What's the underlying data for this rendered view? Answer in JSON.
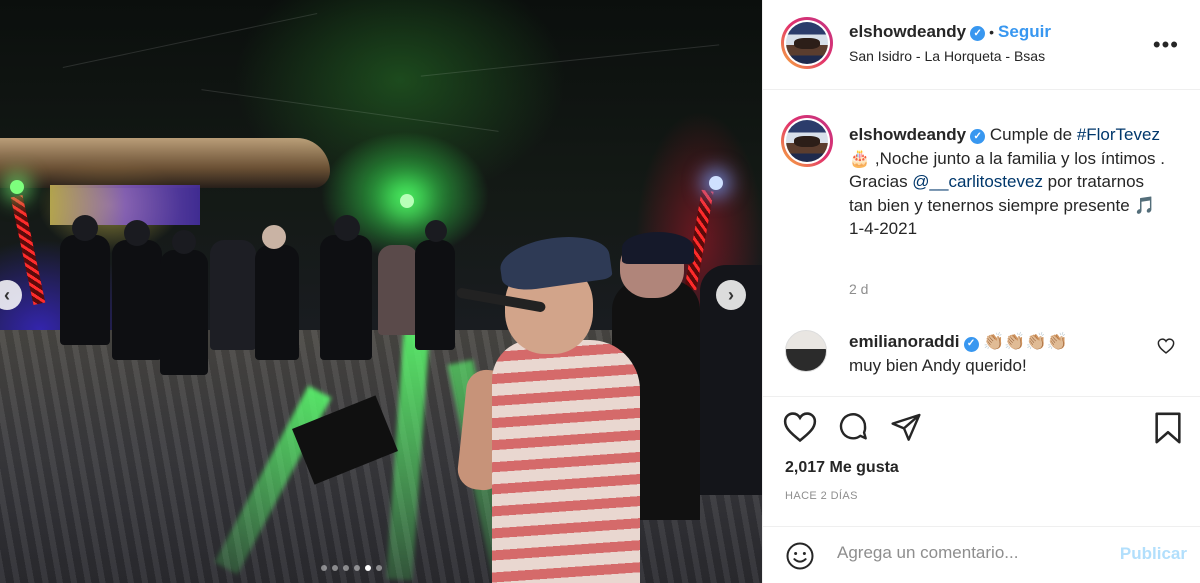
{
  "post": {
    "username": "elshowdeandy",
    "follow_label": "Seguir",
    "separator": "•",
    "location": "San Isidro - La Horqueta - Bsas",
    "more_label": "•••"
  },
  "caption": {
    "username": "elshowdeandy",
    "text_1": " Cumple de ",
    "hashtag": "#FlorTevez",
    "emoji_cake": "🎂",
    "text_2": " ,Noche junto a la familia y los íntimos . Gracias ",
    "mention": "@__carlitostevez",
    "text_3": " por tratarnos tan bien y tenernos siempre presente ",
    "emoji_music": "🎵",
    "date": "1-4-2021",
    "age": "2 d"
  },
  "comment": {
    "username": "emilianoraddi",
    "emojis": "👏🏼👏🏼👏🏼👏🏼",
    "text": "muy bien Andy querido!"
  },
  "stats": {
    "likes": "2,017 Me gusta",
    "time": "HACE 2 DÍAS"
  },
  "add_comment": {
    "placeholder": "Agrega un comentario...",
    "publish": "Publicar"
  },
  "carousel": {
    "prev": "‹",
    "next": "›",
    "total_slides": 6,
    "active_index": 4
  },
  "icons": {
    "verified": "verified-badge-icon",
    "like": "heart-icon",
    "comment": "comment-icon",
    "share": "share-icon",
    "save": "bookmark-icon",
    "emoji": "smile-icon"
  },
  "colors": {
    "link": "#3897f0",
    "tag": "#00376b",
    "muted": "#8e8e8e",
    "publish_disabled": "#b2dffc"
  }
}
